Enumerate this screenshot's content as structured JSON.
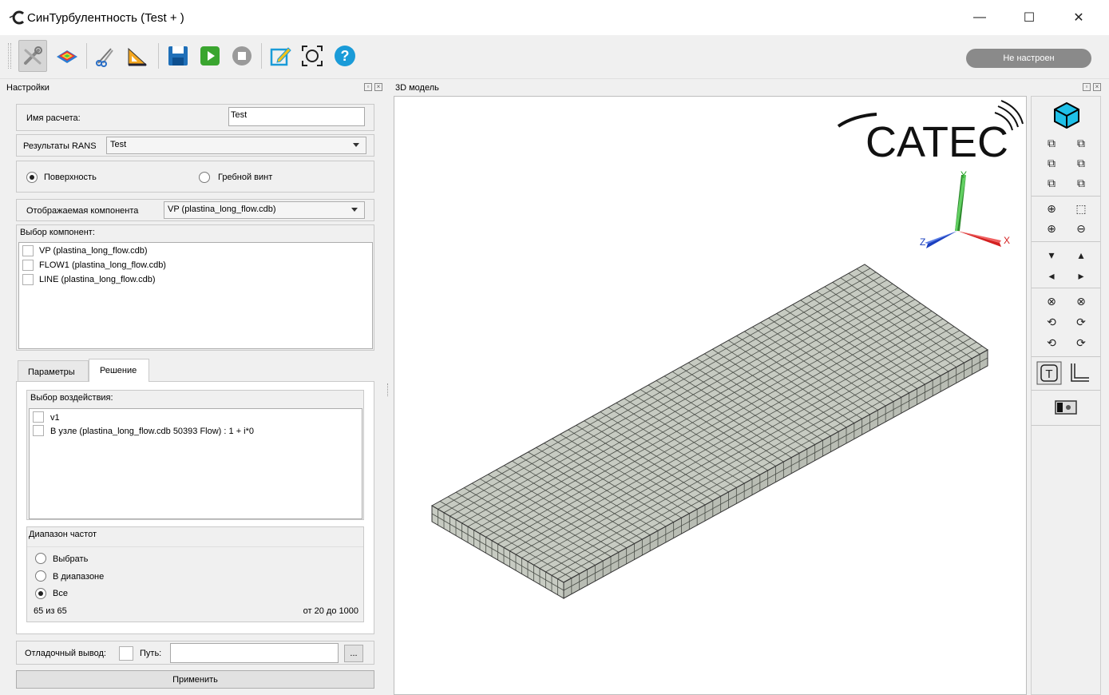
{
  "window": {
    "title": "СинТурбулентность (Test + )",
    "minimize": "—",
    "maximize": "☐",
    "close": "✕"
  },
  "toolbar": {
    "icons": [
      "settings-tools-icon",
      "surface-layers-icon",
      "scissors-icon",
      "ruler-triangle-icon",
      "save-icon",
      "play-icon",
      "stop-icon",
      "edit-icon",
      "fit-view-icon",
      "help-icon"
    ],
    "status": "Не настроен",
    "colors": {
      "save": "#1f6fb8",
      "play": "#3aa52f",
      "stop": "#9a9a9a",
      "help": "#1a9bd8",
      "status_bg": "#8a8a8a"
    }
  },
  "settings_dock": {
    "title": "Настройки",
    "calc_name_label": "Имя расчета:",
    "calc_name_value": "Test",
    "rans_label": "Результаты RANS",
    "rans_value": "Test",
    "radio_surface": "Поверхность",
    "radio_propeller": "Гребной винт",
    "component_label": "Отображаемая компонента",
    "component_value": "VP (plastina_long_flow.cdb)",
    "components_group": "Выбор компонент:",
    "components": [
      "VP (plastina_long_flow.cdb)",
      "FLOW1 (plastina_long_flow.cdb)",
      "LINE (plastina_long_flow.cdb)"
    ],
    "tabs": [
      "Параметры",
      "Решение"
    ],
    "effects_group": "Выбор воздействия:",
    "effects": [
      "v1",
      "В узле (plastina_long_flow.cdb 50393 Flow) : 1 + i*0"
    ],
    "freq_group": "Диапазон частот",
    "freq_options": [
      "Выбрать",
      "В диапазоне",
      "Все"
    ],
    "freq_count": "65 из 65",
    "freq_range": "от 20 до 1000",
    "debug_label": "Отладочный вывод:",
    "path_label": "Путь:",
    "path_value": "",
    "browse": "...",
    "apply": "Применить"
  },
  "model_dock": {
    "title": "3D модель",
    "logo": "CATEC",
    "axes": {
      "x": "X",
      "y": "Y",
      "z": "Z"
    },
    "mesh_color": "#c7cbc2"
  }
}
